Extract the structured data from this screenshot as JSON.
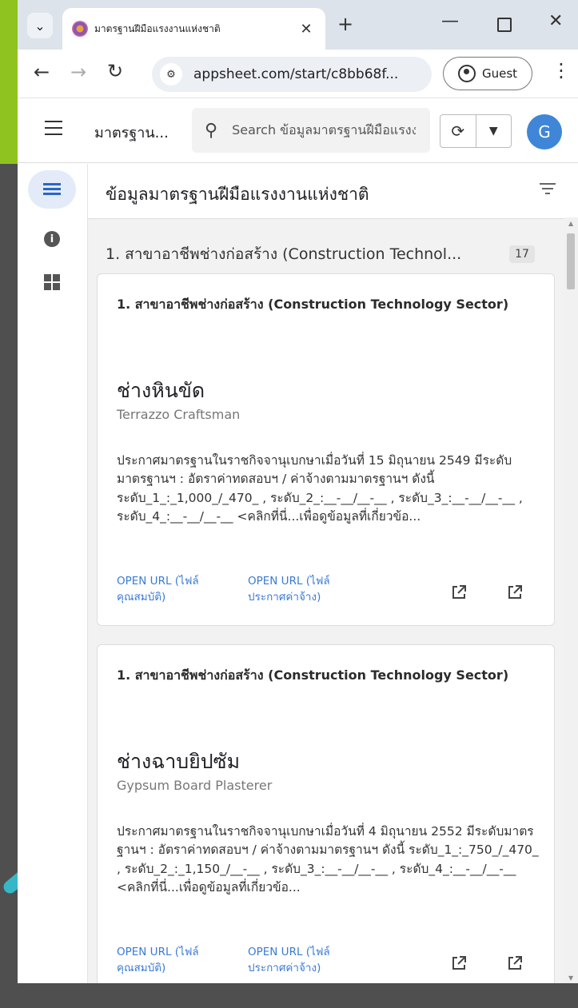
{
  "browser": {
    "tab_title": "มาตรฐานฝีมือแรงงานแห่งชาติ",
    "tab_close": "✕",
    "new_tab": "+",
    "url": "appsheet.com/start/c8bb68f...",
    "profile_label": "Guest"
  },
  "app": {
    "title": "มาตรฐาน...",
    "search_placeholder": "Search ข้อมูลมาตรฐานฝีมือแรงงานแห่งชาติ",
    "avatar_letter": "G"
  },
  "view": {
    "title": "ข้อมูลมาตรฐานฝีมือแรงงานแห่งชาติ"
  },
  "group": {
    "label": "1. สาขาอาชีพช่างก่อสร้าง (Construction Technol...",
    "count": "17"
  },
  "cards": [
    {
      "sector": "1. สาขาอาชีพช่างก่อสร้าง (Construction Technology Sector)",
      "title": "ช่างหินขัด",
      "subtitle": "Terrazzo Craftsman",
      "description": "ประกาศมาตรฐานในราชกิจจานุเบกษาเมื่อวันที่ 15 มิถุนายน 2549 มีระดับมาตรฐานฯ : อัตราค่าทดสอบฯ / ค่าจ้างตามมาตรฐานฯ ดังนี้ ระดับ_1_:_1,000_/_470_ , ระดับ_2_:__-__/__-__ , ระดับ_3_:__-__/__-__ , ระดับ_4_:__-__/__-__ <คลิกที่นี่...เพื่อดูข้อมูลที่เกี่ยวข้อ...",
      "link1": "OPEN URL (ไฟล์คุณสมบัติ)",
      "link2": "OPEN URL (ไฟล์ประกาศค่าจ้าง)"
    },
    {
      "sector": "1. สาขาอาชีพช่างก่อสร้าง (Construction Technology Sector)",
      "title": "ช่างฉาบยิปซัม",
      "subtitle": "Gypsum Board Plasterer",
      "description": "ประกาศมาตรฐานในราชกิจจานุเบกษาเมื่อวันที่ 4 มิถุนายน 2552 มีระดับมาตรฐานฯ : อัตราค่าทดสอบฯ / ค่าจ้างตามมาตรฐานฯ ดังนี้ ระดับ_1_:_750_/_470_ , ระดับ_2_:_1,150_/__-__ , ระดับ_3_:__-__/__-__ , ระดับ_4_:__-__/__-__ <คลิกที่นี่...เพื่อดูข้อมูลที่เกี่ยวข้อ...",
      "link1": "OPEN URL (ไฟล์คุณสมบัติ)",
      "link2": "OPEN URL (ไฟล์ประกาศค่าจ้าง)"
    }
  ],
  "colors": {
    "accent_green": "#8fc31f",
    "link_blue": "#3a7bd5",
    "avatar_blue": "#3f86d8",
    "rail_active": "#e4ebf8"
  },
  "icons": [
    "chevron-down-icon",
    "favicon-icon",
    "close-icon",
    "plus-icon",
    "minimize-icon",
    "maximize-icon",
    "back-icon",
    "forward-icon",
    "reload-icon",
    "site-settings-icon",
    "guest-profile-icon",
    "kebab-menu-icon",
    "hamburger-icon",
    "search-icon",
    "sync-icon",
    "caret-down-icon",
    "list-icon",
    "info-icon",
    "grid-icon",
    "filter-icon",
    "external-link-icon"
  ]
}
